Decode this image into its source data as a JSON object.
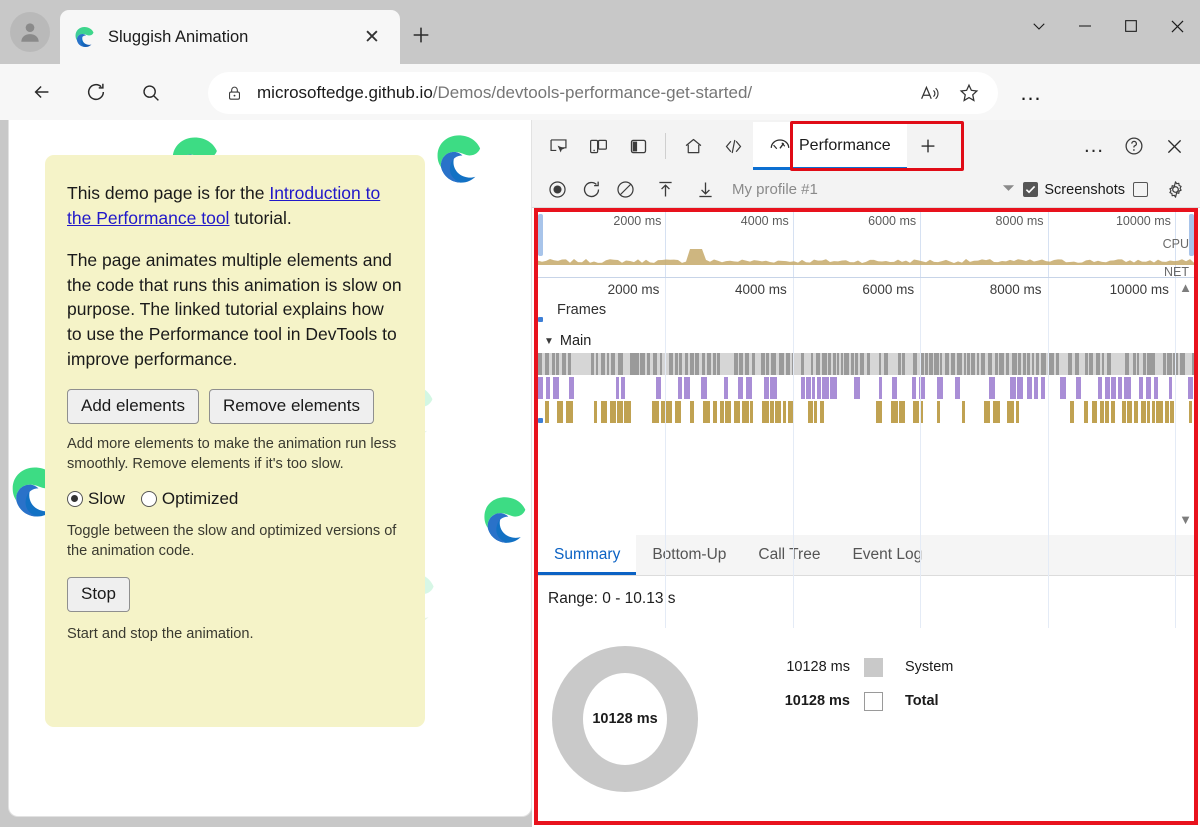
{
  "browser": {
    "tab": {
      "title": "Sluggish Animation",
      "favicon": "edge-logo-icon",
      "close_label": "✕"
    },
    "new_tab_label": "+",
    "window_controls": {
      "more": "⌄",
      "minimize": "–",
      "maximize": "□",
      "close": "✕"
    },
    "nav": {
      "back_icon": "back-arrow-icon",
      "refresh_icon": "refresh-icon",
      "search_icon": "search-icon"
    },
    "address": {
      "lock_icon": "lock-icon",
      "host": "microsoftedge.github.io",
      "path": "/Demos/devtools-performance-get-started/",
      "read_aloud_icon": "read-aloud-icon",
      "favorite_icon": "star-icon"
    },
    "settings_more": "…"
  },
  "page": {
    "paragraph1_before": "This demo page is for the ",
    "paragraph1_link": "Introduction to the Performance tool",
    "paragraph1_after": " tutorial.",
    "paragraph2": "The page animates multiple elements and the code that runs this animation is slow on purpose. The linked tutorial explains how to use the Performance tool in DevTools to improve performance.",
    "add_button": "Add elements",
    "remove_button": "Remove elements",
    "hint1": "Add more elements to make the animation run less smoothly. Remove elements if it's too slow.",
    "radio_slow": "Slow",
    "radio_optimized": "Optimized",
    "hint2": "Toggle between the slow and optimized versions of the animation code.",
    "stop_button": "Stop",
    "hint3": "Start and stop the animation."
  },
  "devtools": {
    "toolbar": {
      "inspect_icon": "inspect-element-icon",
      "device_icon": "device-emulation-icon",
      "dock_icon": "dock-side-icon",
      "home_icon": "home-icon",
      "elements_icon": "code-elements-icon",
      "performance_tab": "Performance",
      "performance_icon": "performance-gauge-icon",
      "add_tab": "+",
      "more_tools": "…",
      "help_icon": "help-icon",
      "close_icon": "close-icon"
    },
    "subbar": {
      "record_icon": "record-circle-icon",
      "reload_record_icon": "reload-and-record-icon",
      "clear_icon": "clear-recording-icon",
      "upload_icon": "upload-profile-icon",
      "download_icon": "download-profile-icon",
      "profile_name": "My profile #1",
      "profile_dropdown_icon": "chevron-down-icon",
      "screenshots_label": "Screenshots",
      "screenshots_checked": true,
      "memory_checkbox_checked": false,
      "settings_icon": "gear-icon"
    },
    "overview": {
      "tick_labels": [
        "2000 ms",
        "4000 ms",
        "6000 ms",
        "8000 ms",
        "10000 ms"
      ],
      "cpu_label": "CPU",
      "net_label": "NET"
    },
    "timeline": {
      "tick_labels": [
        "2000 ms",
        "4000 ms",
        "6000 ms",
        "8000 ms",
        "10000 ms"
      ],
      "frames_label": "Frames",
      "main_label": "Main",
      "expand_icon": "triangle-down-icon",
      "scroll_up_icon": "triangle-up-icon",
      "scroll_down_icon": "triangle-down-icon"
    },
    "detail_tabs": [
      {
        "label": "Summary",
        "active": true
      },
      {
        "label": "Bottom-Up",
        "active": false
      },
      {
        "label": "Call Tree",
        "active": false
      },
      {
        "label": "Event Log",
        "active": false
      }
    ],
    "summary": {
      "range": "Range: 0 - 10.13 s",
      "donut_center": "10128 ms"
    }
  },
  "chart_data": {
    "type": "pie",
    "title": "Range: 0 - 10.13 s",
    "center_label": "10128 ms",
    "labels": [
      "System",
      "Total"
    ],
    "values": [
      10128,
      10128
    ],
    "value_labels": [
      "10128 ms",
      "10128 ms"
    ],
    "colors": [
      "#c9c9c9",
      "#ffffff"
    ],
    "unit": "ms",
    "legend_position": "right"
  },
  "colors": {
    "accent_blue": "#0c6fd1",
    "highlight_red": "#e8121d",
    "card_yellow": "#f5f3c8",
    "link_blue": "#2118c9",
    "flame_gray": "#9a9a9a",
    "flame_purple": "#a98ed6",
    "flame_tan": "#c0a252",
    "donut_gray": "#c9c9c9"
  }
}
